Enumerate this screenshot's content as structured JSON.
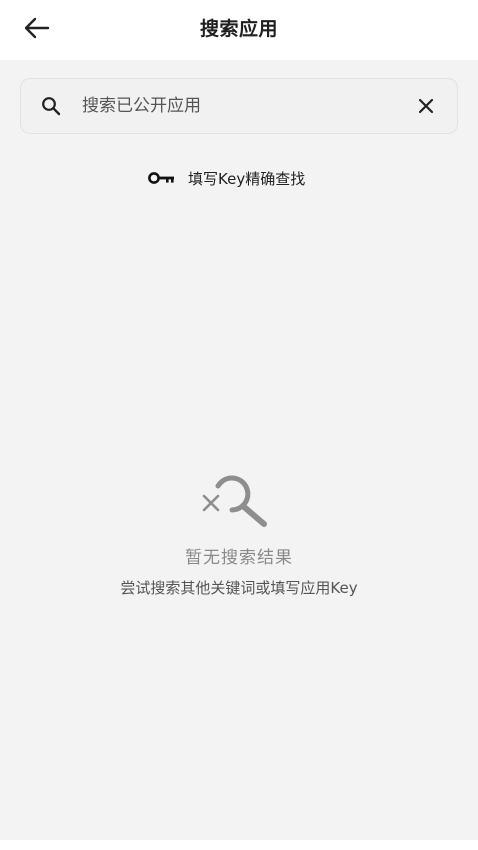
{
  "header": {
    "title": "搜索应用",
    "back_icon": "arrow-left-icon"
  },
  "search": {
    "placeholder": "搜索已公开应用",
    "value": "",
    "search_icon": "search-icon",
    "clear_icon": "close-icon"
  },
  "key_link": {
    "icon": "key-icon",
    "label": "填写Key精确查找"
  },
  "empty_state": {
    "icon": "search-off-icon",
    "title": "暂无搜索结果",
    "hint": "尝试搜索其他关键词或填写应用Key"
  },
  "colors": {
    "background": "#f3f3f3",
    "header": "#ffffff",
    "muted_text": "#8a8a8a",
    "icon_gray": "#8e8e8e"
  }
}
